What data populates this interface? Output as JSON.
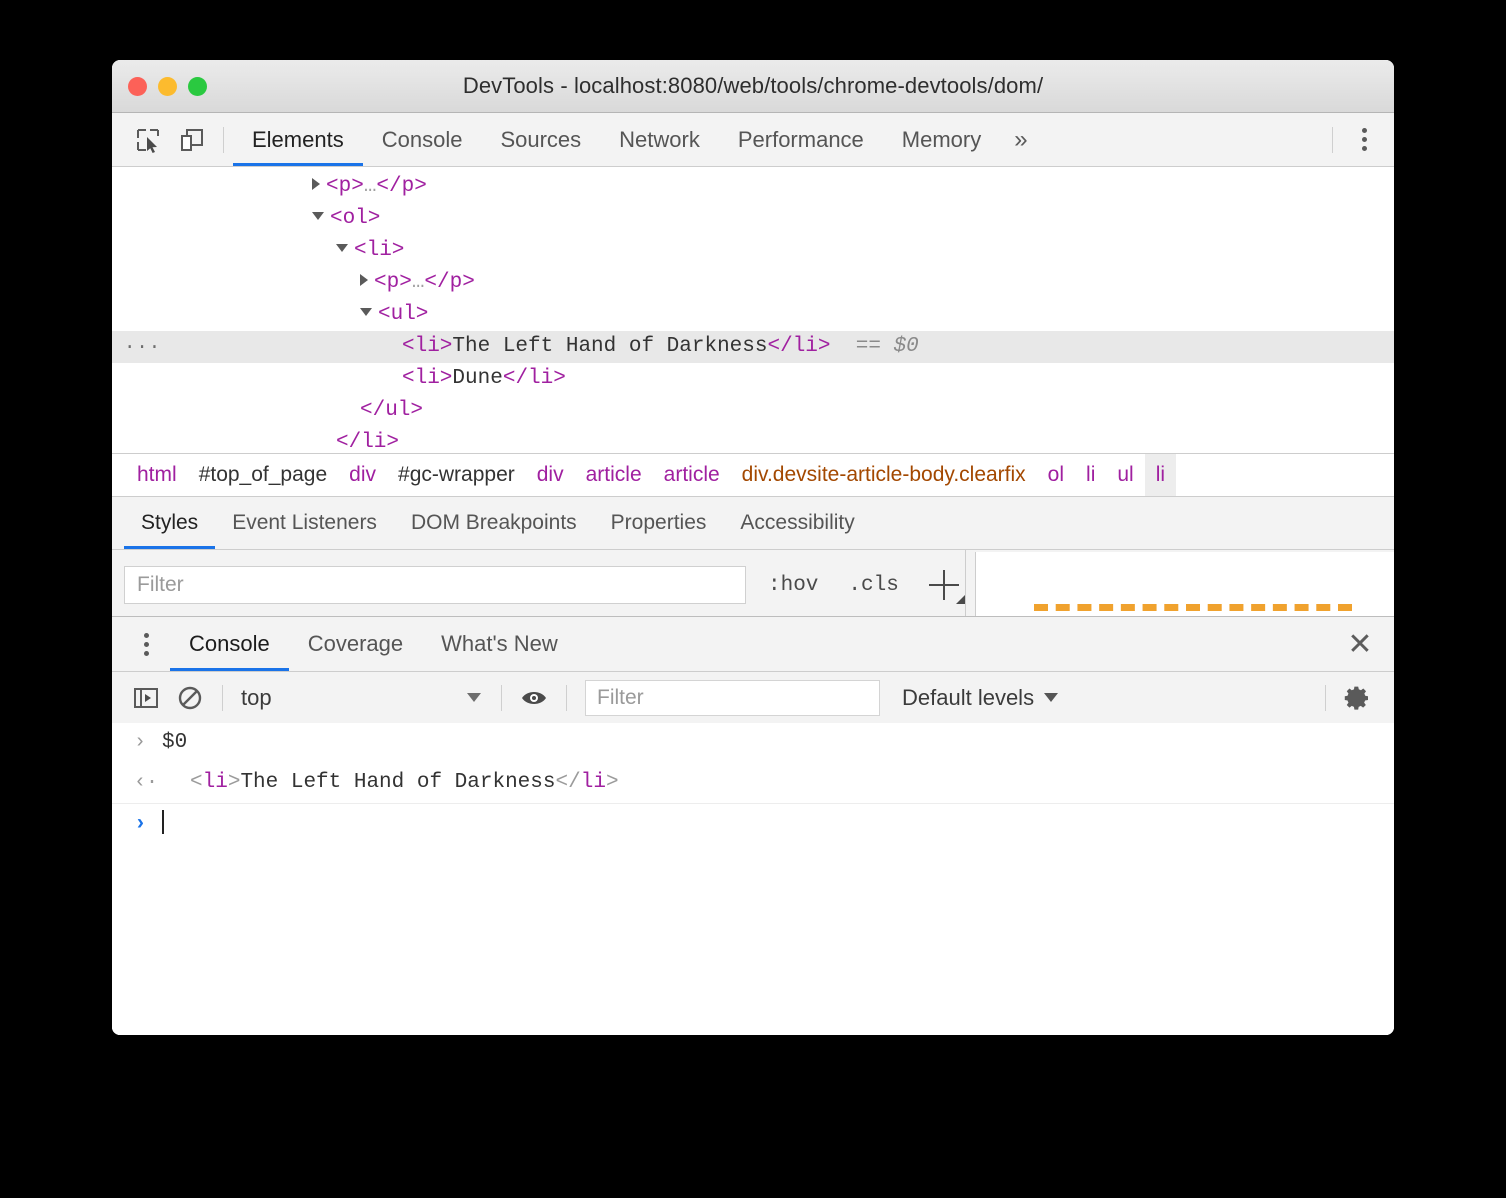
{
  "window": {
    "title": "DevTools - localhost:8080/web/tools/chrome-devtools/dom/",
    "traffic_lights": [
      "close",
      "minimize",
      "maximize"
    ]
  },
  "main_tabs": {
    "inspect_icon": "inspect-element-icon",
    "device_icon": "device-toolbar-icon",
    "items": [
      {
        "label": "Elements",
        "active": true
      },
      {
        "label": "Console",
        "active": false
      },
      {
        "label": "Sources",
        "active": false
      },
      {
        "label": "Network",
        "active": false
      },
      {
        "label": "Performance",
        "active": false
      },
      {
        "label": "Memory",
        "active": false
      }
    ],
    "more_label": "»",
    "menu_icon": "kebab-menu-icon"
  },
  "dom_tree": {
    "rows": [
      {
        "indent": 5,
        "twisty": "closed",
        "open_tag": "<p>",
        "dots": "…",
        "close_tag": "</p>",
        "text": "",
        "selected": false,
        "suffix": ""
      },
      {
        "indent": 5,
        "twisty": "open",
        "open_tag": "<ol>",
        "dots": "",
        "close_tag": "",
        "text": "",
        "selected": false,
        "suffix": ""
      },
      {
        "indent": 6,
        "twisty": "open",
        "open_tag": "<li>",
        "dots": "",
        "close_tag": "",
        "text": "",
        "selected": false,
        "suffix": ""
      },
      {
        "indent": 7,
        "twisty": "closed",
        "open_tag": "<p>",
        "dots": "…",
        "close_tag": "</p>",
        "text": "",
        "selected": false,
        "suffix": ""
      },
      {
        "indent": 7,
        "twisty": "open",
        "open_tag": "<ul>",
        "dots": "",
        "close_tag": "",
        "text": "",
        "selected": false,
        "suffix": ""
      },
      {
        "indent": 8,
        "twisty": "none",
        "open_tag": "<li>",
        "dots": "",
        "close_tag": "</li>",
        "text": "The Left Hand of Darkness",
        "selected": true,
        "suffix": "== $0"
      },
      {
        "indent": 8,
        "twisty": "none",
        "open_tag": "<li>",
        "dots": "",
        "close_tag": "</li>",
        "text": "Dune",
        "selected": false,
        "suffix": ""
      },
      {
        "indent": 7,
        "twisty": "none",
        "open_tag": "",
        "dots": "",
        "close_tag": "</ul>",
        "text": "",
        "selected": false,
        "suffix": ""
      },
      {
        "indent": 6,
        "twisty": "none",
        "open_tag": "",
        "dots": "",
        "close_tag": "</li>",
        "text": "",
        "selected": false,
        "suffix": ""
      }
    ],
    "selected_ellipsis": "···"
  },
  "breadcrumb": {
    "items": [
      {
        "label": "html",
        "style": "tag",
        "selected": false
      },
      {
        "label": "#top_of_page",
        "style": "id",
        "selected": false
      },
      {
        "label": "div",
        "style": "tag",
        "selected": false
      },
      {
        "label": "#gc-wrapper",
        "style": "id",
        "selected": false
      },
      {
        "label": "div",
        "style": "tag",
        "selected": false
      },
      {
        "label": "article",
        "style": "tag",
        "selected": false
      },
      {
        "label": "article",
        "style": "tag",
        "selected": false
      },
      {
        "label": "div.devsite-article-body.clearfix",
        "style": "class",
        "selected": false
      },
      {
        "label": "ol",
        "style": "tag",
        "selected": false
      },
      {
        "label": "li",
        "style": "tag",
        "selected": false
      },
      {
        "label": "ul",
        "style": "tag",
        "selected": false
      },
      {
        "label": "li",
        "style": "tag",
        "selected": true
      }
    ]
  },
  "sidebar_tabs": {
    "items": [
      {
        "label": "Styles",
        "active": true
      },
      {
        "label": "Event Listeners",
        "active": false
      },
      {
        "label": "DOM Breakpoints",
        "active": false
      },
      {
        "label": "Properties",
        "active": false
      },
      {
        "label": "Accessibility",
        "active": false
      }
    ]
  },
  "styles_pane": {
    "filter_placeholder": "Filter",
    "filter_value": "",
    "hov_label": ":hov",
    "cls_label": ".cls",
    "new_rule_icon": "plus-icon",
    "box_model_accent": "#f0a22e"
  },
  "drawer": {
    "menu_icon": "kebab-menu-icon",
    "tabs": [
      {
        "label": "Console",
        "active": true
      },
      {
        "label": "Coverage",
        "active": false
      },
      {
        "label": "What's New",
        "active": false
      }
    ],
    "close_icon": "close-icon",
    "close_glyph": "✕"
  },
  "console_toolbar": {
    "sidebar_icon": "console-sidebar-icon",
    "clear_icon": "clear-console-icon",
    "context": "top",
    "eye_icon": "live-expression-icon",
    "filter_placeholder": "Filter",
    "filter_value": "",
    "levels_label": "Default levels",
    "settings_icon": "gear-icon"
  },
  "console_messages": [
    {
      "kind": "input",
      "gutter": "›",
      "text": "$0",
      "segments": []
    },
    {
      "kind": "output",
      "gutter": "‹·",
      "text": "",
      "segments": [
        {
          "t": "<",
          "c": "brack"
        },
        {
          "t": "li",
          "c": "tag"
        },
        {
          "t": ">",
          "c": "brack"
        },
        {
          "t": "The Left Hand of Darkness",
          "c": "txt"
        },
        {
          "t": "</",
          "c": "brack"
        },
        {
          "t": "li",
          "c": "tag"
        },
        {
          "t": ">",
          "c": "brack"
        }
      ]
    }
  ],
  "console_prompt": {
    "gutter": "›",
    "value": ""
  },
  "colors": {
    "accent_blue": "#1a73e8",
    "tag_purple": "#a020a0",
    "class_brown": "#a34800",
    "selection_gray": "#e8e8e8",
    "box_model_orange": "#f0a22e"
  }
}
